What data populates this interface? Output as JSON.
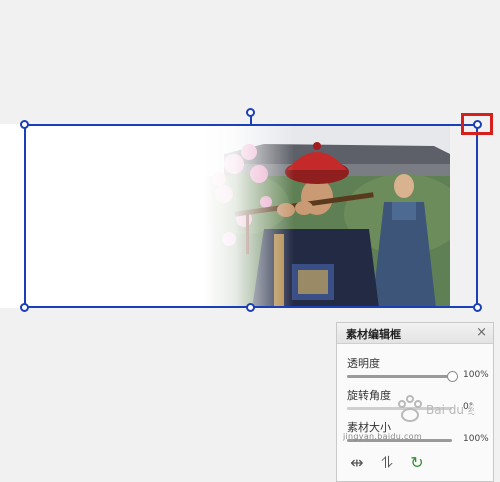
{
  "panel": {
    "title": "素材编辑框",
    "close_glyph": "×",
    "opacity": {
      "label": "透明度",
      "value_text": "100%",
      "level": 1.0
    },
    "rotation": {
      "label": "旋转角度",
      "value_text": "0°",
      "level": 0.0
    },
    "size": {
      "label": "素材大小",
      "value_text": "100%",
      "level": 1.0
    },
    "tools": [
      {
        "name": "flip-horizontal-icon",
        "glyph": "⇹"
      },
      {
        "name": "flip-vertical-icon",
        "glyph": "⥮"
      },
      {
        "name": "rotate-icon",
        "glyph": "↻"
      }
    ]
  },
  "watermark": {
    "logo_text": "Bai du 经验",
    "url": "jingyan.baidu.com"
  },
  "colors": {
    "selection": "#1a3fb8",
    "highlight": "#d6201d",
    "canvas": "#f1f1f1",
    "panel": "#fafafa"
  },
  "photo": {
    "description_icon": "photo-material",
    "subjects": [
      "man-in-red-hat-playing-flute",
      "standing-man-in-blue-robe",
      "pink-blossom-tree"
    ]
  }
}
